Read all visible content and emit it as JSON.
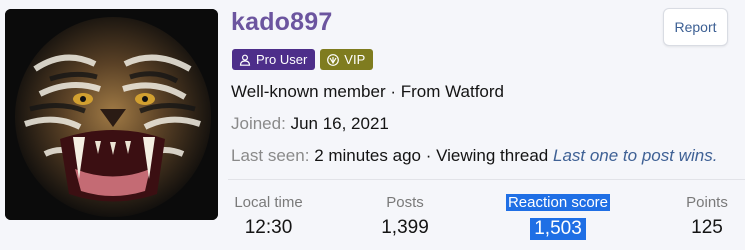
{
  "profile": {
    "username": "kado897",
    "report_label": "Report",
    "badges": [
      {
        "label": "Pro User",
        "icon": "user-icon"
      },
      {
        "label": "VIP",
        "icon": "vip-icon"
      }
    ],
    "member_line": "Well-known member · From Watford",
    "joined_label": "Joined:",
    "joined_value": "Jun 16, 2021",
    "last_seen_label": "Last seen:",
    "last_seen_value": "2 minutes ago · Viewing thread",
    "last_seen_thread": "Last one to post wins."
  },
  "stats": [
    {
      "label": "Local time",
      "value": "12:30"
    },
    {
      "label": "Posts",
      "value": "1,399"
    },
    {
      "label": "Reaction score",
      "value": "1,503"
    },
    {
      "label": "Points",
      "value": "125"
    }
  ],
  "colors": {
    "username": "#6c559f",
    "pro_badge": "#4d2e8a",
    "vip_badge": "#7f7c1f",
    "link": "#3f6195",
    "selection": "#1f6fe5"
  }
}
